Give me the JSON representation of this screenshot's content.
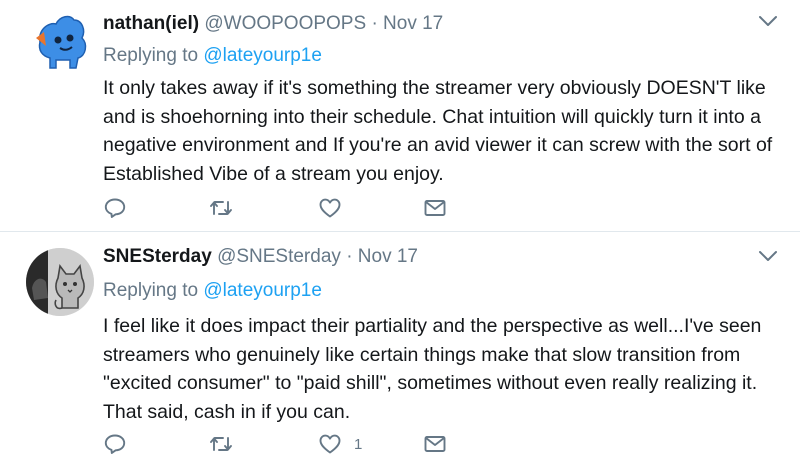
{
  "tweets": [
    {
      "display_name": "nathan(iel)",
      "handle": "@WOOPOOPOPS",
      "separator": "·",
      "date": "Nov 17",
      "replying_label": "Replying to",
      "replying_to": "@lateyourp1e",
      "text": "It only takes away if it's something the streamer very obviously DOESN'T like and is shoehorning into their schedule. Chat intuition will quickly turn it into a negative environment and If you're an avid viewer it can screw with the sort of Established Vibe of a stream you enjoy.",
      "like_count": ""
    },
    {
      "display_name": "SNESterday",
      "handle": "@SNESterday",
      "separator": "·",
      "date": "Nov 17",
      "replying_label": "Replying to",
      "replying_to": "@lateyourp1e",
      "text": "I feel like it does impact their partiality and the perspective as well...I've seen streamers who genuinely like certain things make that slow transition from \"excited consumer\" to \"paid shill\", sometimes without even really realizing it. That said, cash in if you can.",
      "like_count": "1"
    }
  ],
  "colors": {
    "link": "#1da1f2",
    "secondary_text": "#657786",
    "primary_text": "#14171a",
    "icon": "#657786",
    "divider": "#e1e8ed"
  },
  "icons": [
    "reply-icon",
    "retweet-icon",
    "heart-icon",
    "direct-message-icon",
    "chevron-down-icon"
  ]
}
